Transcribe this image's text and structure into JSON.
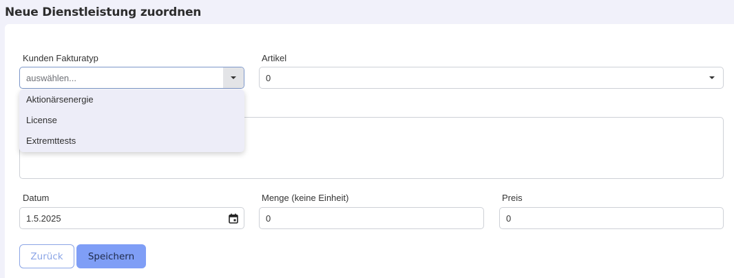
{
  "page": {
    "title": "Neue Dienstleistung zuordnen"
  },
  "form": {
    "customer_type": {
      "label": "Kunden Fakturatyp",
      "placeholder": "auswählen...",
      "options": [
        "Aktionärsenergie",
        "License",
        "Extremttests"
      ]
    },
    "article": {
      "label": "Artikel",
      "value": "0"
    },
    "date": {
      "label": "Datum",
      "value": "1.5.2025"
    },
    "quantity": {
      "label": "Menge (keine Einheit)",
      "value": "0"
    },
    "price": {
      "label": "Preis",
      "value": "0"
    }
  },
  "buttons": {
    "back": "Zurück",
    "save": "Speichern"
  },
  "colors": {
    "accent": "#7f9ef6",
    "outline": "#8aa4e6",
    "background": "#f1f1fa"
  },
  "icons": {
    "select_toggle": "chevron-down-icon",
    "date": "calendar-icon"
  }
}
